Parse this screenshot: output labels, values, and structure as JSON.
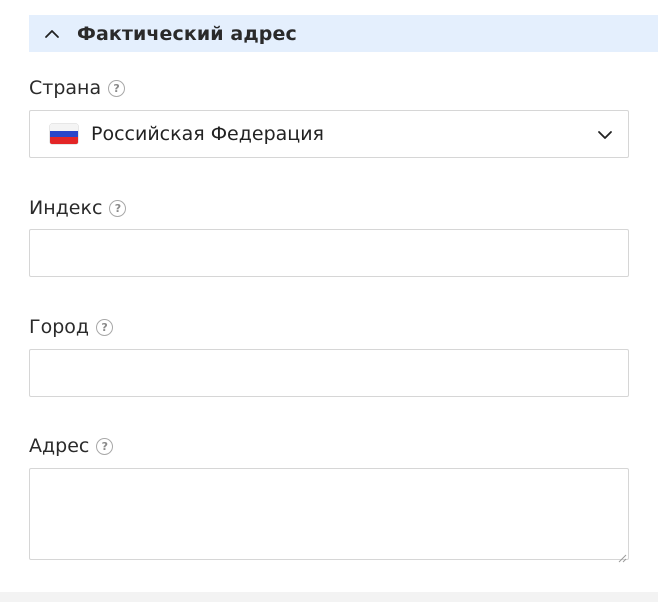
{
  "section": {
    "title": "Фактический адрес",
    "expanded": true,
    "header_bg": "#e4effd"
  },
  "fields": {
    "country": {
      "label": "Страна",
      "value": "Российская Федерация",
      "flag_icon": "russia-flag-icon"
    },
    "zip": {
      "label": "Индекс",
      "value": ""
    },
    "city": {
      "label": "Город",
      "value": ""
    },
    "address": {
      "label": "Адрес",
      "value": ""
    }
  },
  "help_glyph": "?"
}
